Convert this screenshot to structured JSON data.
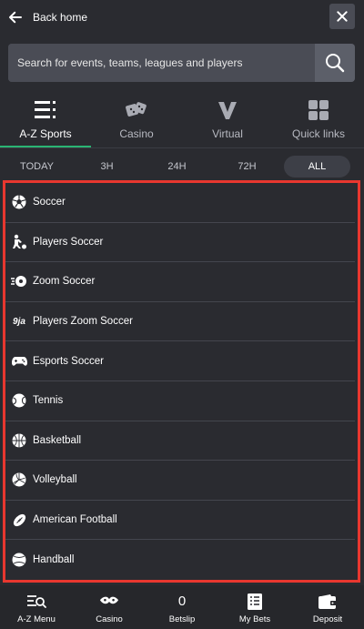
{
  "header": {
    "back_label": "Back home"
  },
  "search": {
    "placeholder": "Search for events, teams, leagues and players"
  },
  "categories": [
    {
      "label": "A-Z Sports",
      "icon": "az-sports-icon",
      "active": true
    },
    {
      "label": "Casino",
      "icon": "dice-icon",
      "active": false
    },
    {
      "label": "Virtual",
      "icon": "virtual-v-icon",
      "active": false
    },
    {
      "label": "Quick links",
      "icon": "grid-icon",
      "active": false
    }
  ],
  "time_filters": [
    {
      "label": "TODAY",
      "active": false
    },
    {
      "label": "3H",
      "active": false
    },
    {
      "label": "24H",
      "active": false
    },
    {
      "label": "72H",
      "active": false
    },
    {
      "label": "ALL",
      "active": true
    }
  ],
  "sports": [
    {
      "label": "Soccer",
      "icon": "soccer-ball-icon"
    },
    {
      "label": "Players Soccer",
      "icon": "player-icon"
    },
    {
      "label": "Zoom Soccer",
      "icon": "zoom-ball-icon"
    },
    {
      "label": "Players Zoom Soccer",
      "icon": "9ja-icon",
      "icon_text": "9ja"
    },
    {
      "label": "Esports Soccer",
      "icon": "gamepad-icon"
    },
    {
      "label": "Tennis",
      "icon": "tennis-ball-icon"
    },
    {
      "label": "Basketball",
      "icon": "basketball-icon"
    },
    {
      "label": "Volleyball",
      "icon": "volleyball-icon"
    },
    {
      "label": "American Football",
      "icon": "american-football-icon"
    },
    {
      "label": "Handball",
      "icon": "handball-icon"
    }
  ],
  "bottom_nav": [
    {
      "label": "A-Z Menu",
      "icon": "menu-search-icon"
    },
    {
      "label": "Casino",
      "icon": "casino-icon"
    },
    {
      "label": "Betslip",
      "count": "0"
    },
    {
      "label": "My Bets",
      "icon": "ticket-icon"
    },
    {
      "label": "Deposit",
      "icon": "wallet-icon"
    }
  ],
  "colors": {
    "background": "#2a2b30",
    "accent_green": "#2ab573",
    "highlight_border": "#e8372f"
  }
}
